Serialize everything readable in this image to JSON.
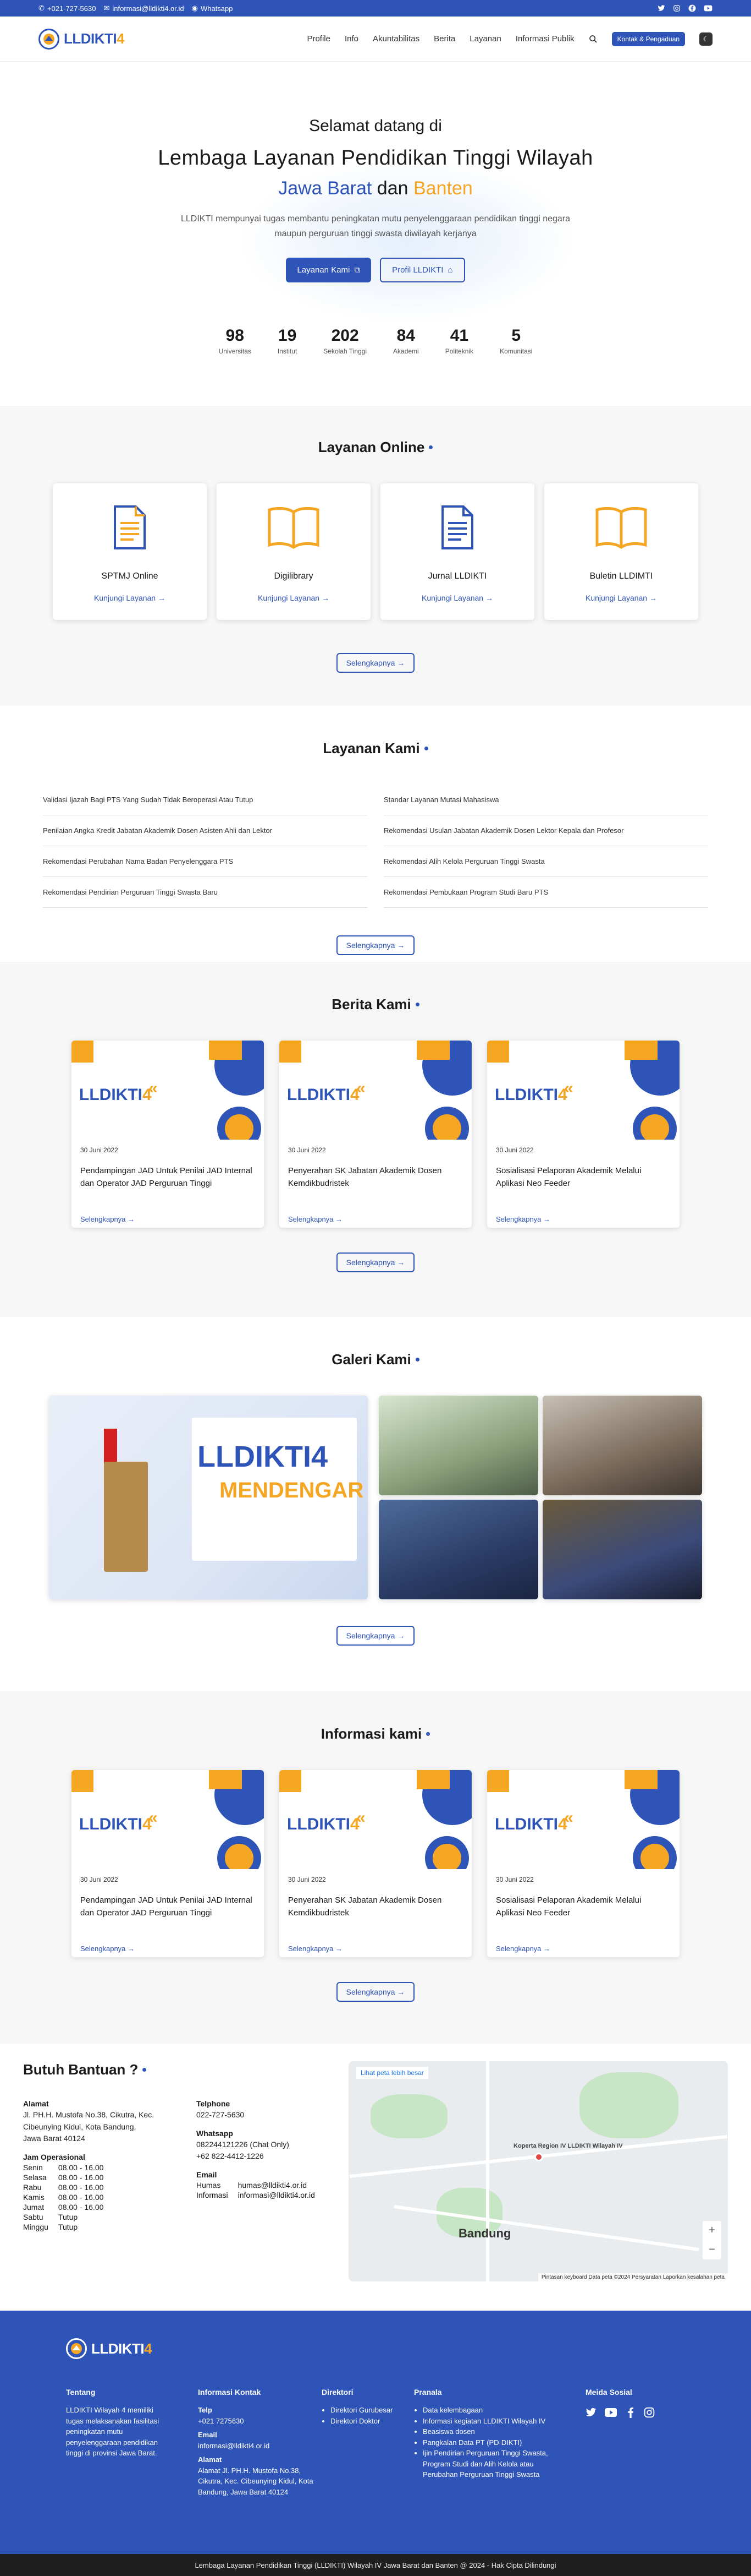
{
  "topbar": {
    "phone": "+021-727-5630",
    "email": "informasi@lldikti4.or.id",
    "whatsapp": "Whatsapp"
  },
  "nav": {
    "logo_text": "LLDIKTI",
    "logo_number": "4",
    "items": [
      "Profile",
      "Info",
      "Akuntabilitas",
      "Berita",
      "Layanan",
      "Informasi Publik"
    ],
    "cta": "Kontak & Pengaduan"
  },
  "hero": {
    "welcome": "Selamat datang di",
    "title": "Lembaga Layanan Pendidikan Tinggi Wilayah",
    "region_a": "Jawa Barat",
    "region_and": "dan",
    "region_b": "Banten",
    "description": "LLDIKTI mempunyai tugas membantu peningkatan mutu penyelenggaraan pendidikan tinggi negara maupun perguruan tinggi swasta diwilayah kerjanya",
    "btn_primary": "Layanan Kami",
    "btn_secondary": "Profil LLDIKTI",
    "stats": [
      {
        "n": "98",
        "l": "Universitas"
      },
      {
        "n": "19",
        "l": "Institut"
      },
      {
        "n": "202",
        "l": "Sekolah Tinggi"
      },
      {
        "n": "84",
        "l": "Akademi"
      },
      {
        "n": "41",
        "l": "Politeknik"
      },
      {
        "n": "5",
        "l": "Komunitasi"
      }
    ]
  },
  "layanan_online": {
    "title": "Layanan Online",
    "cards": [
      {
        "title": "SPTMJ Online",
        "link": "Kunjungi Layanan →",
        "icon": "document-icon"
      },
      {
        "title": "Digilibrary",
        "link": "Kunjungi Layanan →",
        "icon": "book-icon"
      },
      {
        "title": "Jurnal LLDIKTI",
        "link": "Kunjungi Layanan →",
        "icon": "document-icon"
      },
      {
        "title": "Buletin LLDIMTI",
        "link": "Kunjungi Layanan →",
        "icon": "book-icon"
      }
    ],
    "more": "Selengkapnya →"
  },
  "layanan_kami": {
    "title": "Layanan Kami",
    "items": [
      "Validasi Ijazah Bagi PTS Yang Sudah Tidak Beroperasi Atau Tutup",
      "Standar Layanan Mutasi Mahasiswa",
      "Penilaian Angka Kredit Jabatan Akademik Dosen Asisten Ahli dan Lektor",
      "Rekomendasi Usulan Jabatan Akademik Dosen Lektor Kepala dan Profesor",
      "Rekomendasi Perubahan Nama Badan Penyelenggara PTS",
      "Rekomendasi Alih Kelola Perguruan Tinggi Swasta",
      "Rekomendasi Pendirian Perguruan Tinggi Swasta Baru",
      "Rekomendasi Pembukaan Program Studi Baru PTS"
    ],
    "more": "Selengkapnya →"
  },
  "berita": {
    "title": "Berita Kami",
    "cards": [
      {
        "date": "30 Juni 2022",
        "title": "Pendampingan JAD Untuk Penilai JAD Internal dan Operator JAD Perguruan Tinggi",
        "link": "Selengkapnya →"
      },
      {
        "date": "30 Juni 2022",
        "title": "Penyerahan SK Jabatan Akademik Dosen Kemdikbudristek",
        "link": "Selengkapnya →"
      },
      {
        "date": "30 Juni 2022",
        "title": "Sosialisasi Pelaporan Akademik Melalui Aplikasi Neo Feeder",
        "link": "Selengkapnya →"
      }
    ],
    "more": "Selengkapnya →"
  },
  "galeri": {
    "title": "Galeri Kami",
    "banner_title": "LLDIKTI4",
    "banner_sub": "MENDENGAR",
    "more": "Selengkapnya →"
  },
  "informasi": {
    "title": "Informasi kami",
    "cards": [
      {
        "date": "30 Juni 2022",
        "title": "Pendampingan JAD Untuk Penilai JAD Internal dan Operator JAD Perguruan Tinggi",
        "link": "Selengkapnya →"
      },
      {
        "date": "30 Juni 2022",
        "title": "Penyerahan SK Jabatan Akademik Dosen Kemdikbudristek",
        "link": "Selengkapnya →"
      },
      {
        "date": "30 Juni 2022",
        "title": "Sosialisasi Pelaporan Akademik Melalui Aplikasi Neo Feeder",
        "link": "Selengkapnya →"
      }
    ],
    "more": "Selengkapnya →"
  },
  "help": {
    "title": "Butuh Bantuan ?",
    "alamat_label": "Alamat",
    "alamat": "Jl. PH.H. Mustofa No.38, Cikutra, Kec. Cibeunying Kidul, Kota Bandung, Jawa Barat 40124",
    "jam_label": "Jam Operasional",
    "jam": [
      {
        "d": "Senin",
        "t": "08.00 - 16.00"
      },
      {
        "d": "Selasa",
        "t": "08.00 - 16.00"
      },
      {
        "d": "Rabu",
        "t": "08.00 - 16.00"
      },
      {
        "d": "Kamis",
        "t": "08.00 - 16.00"
      },
      {
        "d": "Jumat",
        "t": "08.00 - 16.00"
      },
      {
        "d": "Sabtu",
        "t": "Tutup"
      },
      {
        "d": "Minggu",
        "t": "Tutup"
      }
    ],
    "telephone_label": "Telphone",
    "telephone": "022-727-5630",
    "whatsapp_label": "Whatsapp",
    "whatsapp_1": "082244121226 (Chat Only)",
    "whatsapp_2": "+62 822-4412-1226",
    "email_label": "Email",
    "emails": [
      {
        "k": "Humas",
        "v": "humas@lldikti4.or.id"
      },
      {
        "k": "Informasi",
        "v": "informasi@lldikti4.or.id"
      }
    ],
    "map": {
      "open": "Lihat peta lebih besar",
      "place": "Koperta Region IV LLDIKTI Wilayah IV",
      "city": "Bandung",
      "footer": "Pintasan keyboard   Data peta ©2024   Persyaratan   Laporkan kesalahan peta"
    }
  },
  "footer": {
    "logo_text": "LLDIKTI",
    "logo_number": "4",
    "tentang_title": "Tentang",
    "tentang": "LLDIKTI Wilayah 4 memiliki tugas melaksanakan fasilitasi peningkatan mutu penyelenggaraan pendidikan tinggi di provinsi Jawa Barat.",
    "kontak_title": "Informasi Kontak",
    "telp_label": "Telp",
    "telp": "+021 7275630",
    "email_label": "Email",
    "email": "informasi@lldikti4.or.id",
    "alamat_label": "Alamat",
    "alamat": "Alamat Jl. PH.H. Mustofa No.38, Cikutra, Kec. Cibeunying Kidul, Kota Bandung, Jawa Barat 40124",
    "direktori_title": "Direktori",
    "direktori": [
      "Direktori Gurubesar",
      "Direktori Doktor"
    ],
    "pranala_title": "Pranala",
    "pranala": [
      "Data kelembagaan",
      "Informasi kegiatan LLDIKTI Wilayah IV",
      "Beasiswa dosen",
      "Pangkalan Data PT (PD-DIKTI)",
      "Ijin Pendirian Perguruan Tinggi Swasta, Program Studi dan Alih Kelola atau Perubahan Perguruan Tinggi Swasta"
    ],
    "sosial_title": "Meida Sosial",
    "copyright": "Lembaga Layanan Pendidikan Tinggi (LLDIKTI) Wilayah IV Jawa Barat dan Banten @ 2024 - Hak Cipta Dilindungi"
  }
}
